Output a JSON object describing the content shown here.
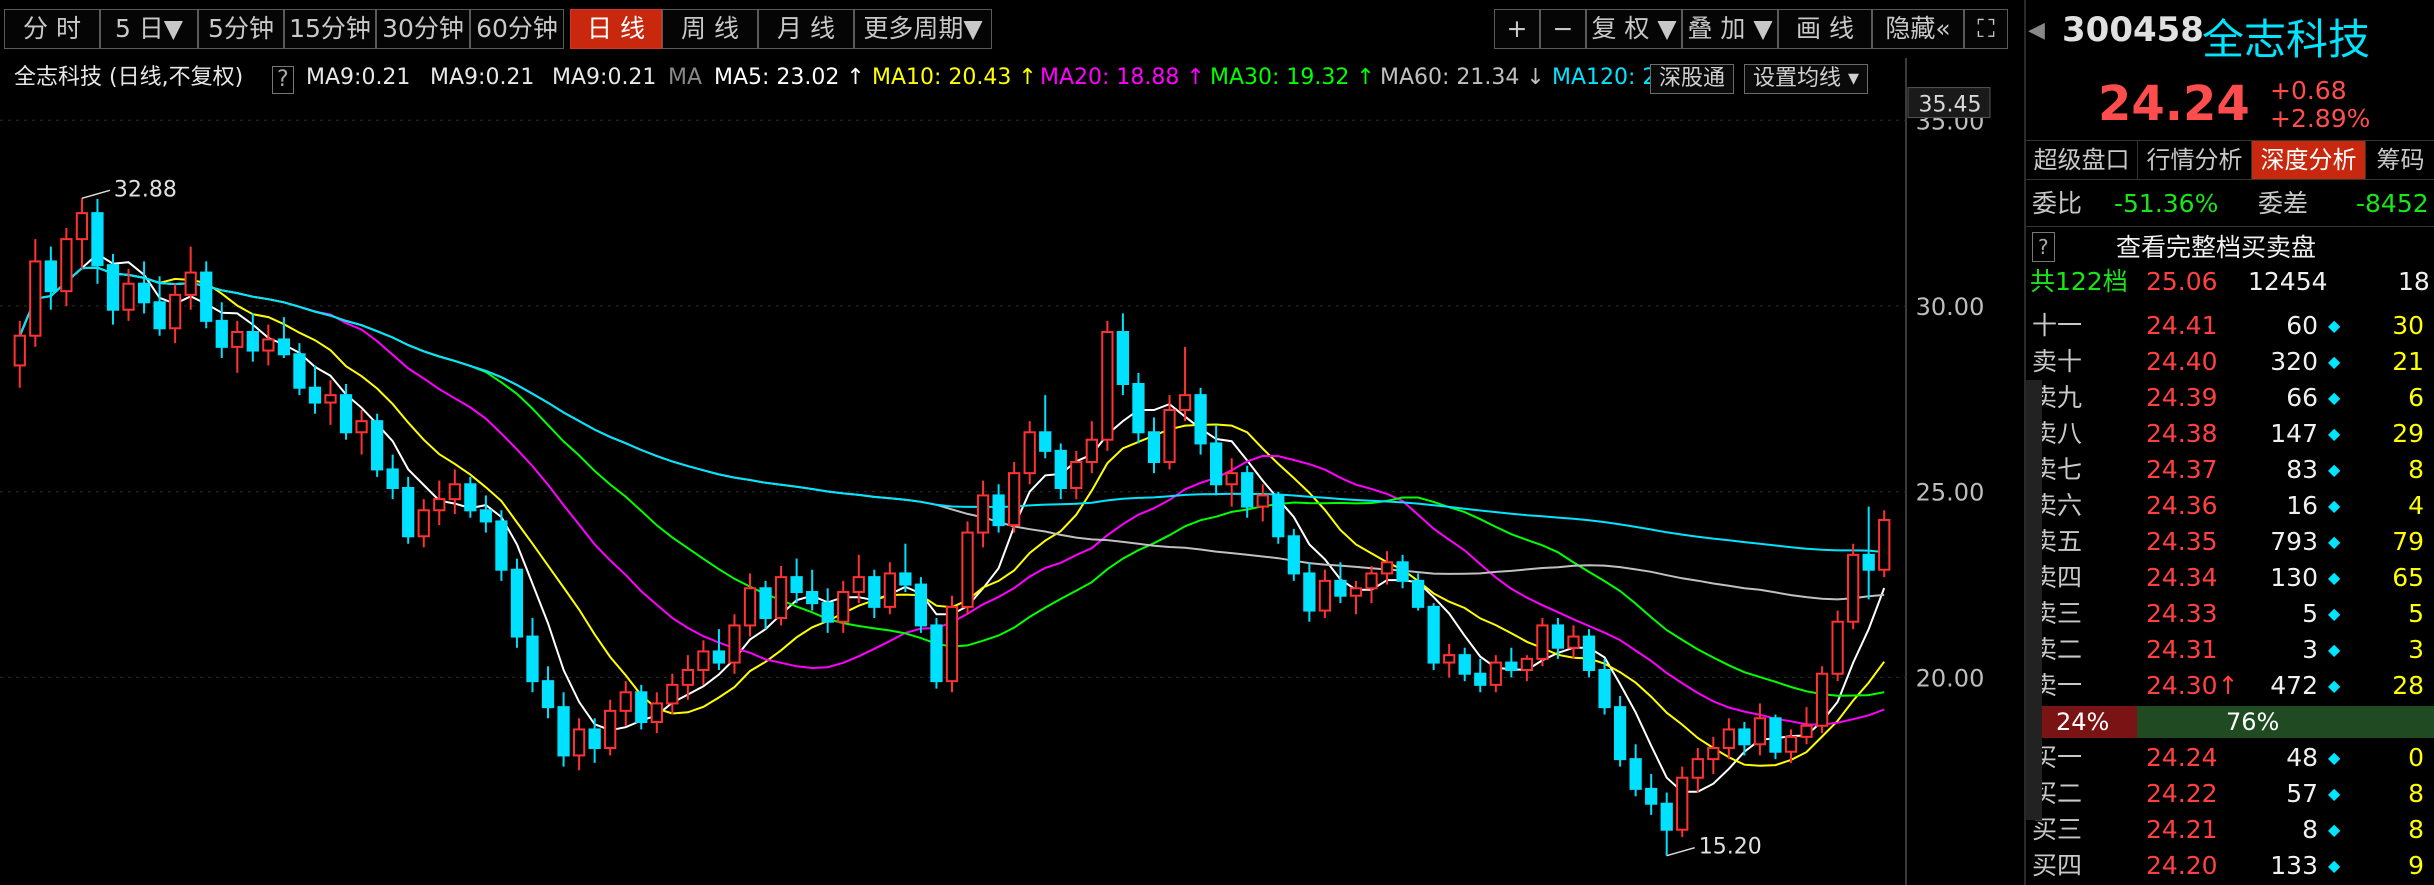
{
  "toolbar": {
    "left_buttons": [
      "分 时",
      "5 日▼",
      "5分钟",
      "15分钟",
      "30分钟",
      "60分钟",
      "日 线",
      "周 线",
      "月 线",
      "更多周期▼"
    ],
    "active": "日 线",
    "right_buttons": [
      "+",
      "−",
      "复 权 ▼",
      "叠 加 ▼",
      "画 线",
      "隐藏«",
      "⛶"
    ]
  },
  "indicators": {
    "title": "全志科技 (日线,不复权)",
    "help": "?",
    "ma9_a": "MA9:0.21",
    "ma9_b": "MA9:0.21",
    "ma9_c": "MA9:0.21",
    "ma": "MA",
    "ma5": "MA5: 23.02 ↑",
    "ma10": "MA10: 20.43 ↑",
    "ma20": "MA20: 18.88 ↑",
    "ma30": "MA30: 19.32 ↑",
    "ma60": "MA60: 21.34 ↓",
    "ma120": "MA120: 2",
    "deep_link": "深股通",
    "setting": "设置均线 ▾",
    "colors": {
      "ma5": "#ffffff",
      "ma10": "#ffff00",
      "ma20": "#ff00ff",
      "ma30": "#00ff00",
      "ma60": "#c0c0c0",
      "ma120": "#00e5ff"
    }
  },
  "chart_data": {
    "type": "candlestick",
    "y_axis": {
      "ticks": [
        "35.00",
        "30.00",
        "25.00",
        "20.00"
      ],
      "tick_values": [
        35,
        30,
        25,
        20
      ],
      "ylim": [
        14.6,
        35.6
      ],
      "current_marker": "35.45"
    },
    "annotations": {
      "high": "32.88",
      "low": "15.20"
    },
    "candles": [
      [
        28.4,
        29.6,
        27.8,
        29.2
      ],
      [
        29.2,
        31.8,
        28.9,
        31.2
      ],
      [
        31.2,
        31.6,
        29.9,
        30.4
      ],
      [
        30.4,
        32.1,
        30.0,
        31.8
      ],
      [
        31.8,
        32.9,
        31.0,
        32.5
      ],
      [
        32.5,
        32.88,
        30.6,
        31.1
      ],
      [
        31.1,
        31.4,
        29.5,
        29.9
      ],
      [
        29.9,
        31.0,
        29.6,
        30.6
      ],
      [
        30.6,
        31.2,
        29.8,
        30.1
      ],
      [
        30.1,
        30.8,
        29.2,
        29.4
      ],
      [
        29.4,
        30.6,
        29.0,
        30.3
      ],
      [
        30.3,
        31.6,
        29.9,
        30.9
      ],
      [
        30.9,
        31.2,
        29.4,
        29.6
      ],
      [
        29.6,
        30.1,
        28.6,
        28.9
      ],
      [
        28.9,
        29.6,
        28.2,
        29.3
      ],
      [
        29.3,
        29.8,
        28.5,
        28.8
      ],
      [
        28.8,
        29.5,
        28.4,
        29.1
      ],
      [
        29.1,
        29.7,
        28.6,
        28.7
      ],
      [
        28.7,
        29.0,
        27.6,
        27.8
      ],
      [
        27.8,
        28.4,
        27.1,
        27.4
      ],
      [
        27.4,
        28.0,
        26.8,
        27.6
      ],
      [
        27.6,
        27.9,
        26.4,
        26.6
      ],
      [
        26.6,
        27.2,
        26.0,
        26.9
      ],
      [
        26.9,
        27.1,
        25.4,
        25.6
      ],
      [
        25.6,
        26.0,
        24.8,
        25.1
      ],
      [
        25.1,
        25.4,
        23.6,
        23.8
      ],
      [
        23.8,
        24.8,
        23.5,
        24.5
      ],
      [
        24.5,
        25.3,
        24.1,
        24.8
      ],
      [
        24.8,
        25.6,
        24.4,
        25.2
      ],
      [
        25.2,
        25.4,
        24.3,
        24.5
      ],
      [
        24.5,
        24.9,
        23.9,
        24.2
      ],
      [
        24.2,
        24.5,
        22.6,
        22.9
      ],
      [
        22.9,
        23.2,
        20.8,
        21.1
      ],
      [
        21.1,
        21.6,
        19.6,
        19.9
      ],
      [
        19.9,
        20.3,
        18.9,
        19.2
      ],
      [
        19.2,
        19.6,
        17.6,
        17.9
      ],
      [
        17.9,
        18.9,
        17.5,
        18.6
      ],
      [
        18.6,
        18.9,
        17.7,
        18.1
      ],
      [
        18.1,
        19.4,
        17.9,
        19.1
      ],
      [
        19.1,
        19.9,
        18.7,
        19.6
      ],
      [
        19.6,
        19.8,
        18.6,
        18.8
      ],
      [
        18.8,
        19.6,
        18.5,
        19.3
      ],
      [
        19.3,
        20.1,
        19.0,
        19.8
      ],
      [
        19.8,
        20.6,
        19.4,
        20.2
      ],
      [
        20.2,
        21.0,
        19.8,
        20.7
      ],
      [
        20.7,
        21.3,
        20.2,
        20.4
      ],
      [
        20.4,
        21.7,
        20.1,
        21.4
      ],
      [
        21.4,
        22.8,
        21.1,
        22.4
      ],
      [
        22.4,
        22.6,
        21.3,
        21.6
      ],
      [
        21.6,
        23.0,
        21.4,
        22.7
      ],
      [
        22.7,
        23.2,
        22.0,
        22.3
      ],
      [
        22.3,
        22.9,
        21.8,
        22.0
      ],
      [
        22.0,
        22.4,
        21.2,
        21.5
      ],
      [
        21.5,
        22.6,
        21.2,
        22.3
      ],
      [
        22.3,
        23.3,
        22.0,
        22.7
      ],
      [
        22.7,
        22.9,
        21.6,
        21.9
      ],
      [
        21.9,
        23.1,
        21.7,
        22.8
      ],
      [
        22.8,
        23.6,
        22.3,
        22.5
      ],
      [
        22.5,
        22.7,
        21.2,
        21.4
      ],
      [
        21.4,
        21.6,
        19.7,
        19.9
      ],
      [
        19.9,
        22.2,
        19.6,
        21.9
      ],
      [
        21.9,
        24.2,
        21.7,
        23.9
      ],
      [
        23.9,
        25.3,
        23.5,
        24.9
      ],
      [
        24.9,
        25.2,
        23.9,
        24.1
      ],
      [
        24.1,
        25.8,
        23.9,
        25.5
      ],
      [
        25.5,
        26.9,
        25.2,
        26.6
      ],
      [
        26.6,
        27.6,
        25.9,
        26.1
      ],
      [
        26.1,
        26.3,
        24.8,
        25.1
      ],
      [
        25.1,
        26.1,
        24.8,
        25.8
      ],
      [
        25.8,
        26.9,
        25.5,
        26.4
      ],
      [
        26.4,
        29.6,
        26.1,
        29.3
      ],
      [
        29.3,
        29.8,
        27.6,
        27.9
      ],
      [
        27.9,
        28.2,
        26.3,
        26.6
      ],
      [
        26.6,
        27.0,
        25.5,
        25.8
      ],
      [
        25.8,
        27.6,
        25.6,
        27.2
      ],
      [
        27.2,
        28.9,
        26.9,
        27.6
      ],
      [
        27.6,
        27.8,
        26.0,
        26.3
      ],
      [
        26.3,
        26.8,
        24.9,
        25.2
      ],
      [
        25.2,
        25.9,
        24.6,
        25.5
      ],
      [
        25.5,
        25.7,
        24.3,
        24.6
      ],
      [
        24.6,
        25.2,
        24.2,
        24.9
      ],
      [
        24.9,
        25.0,
        23.6,
        23.8
      ],
      [
        23.8,
        24.0,
        22.6,
        22.8
      ],
      [
        22.8,
        23.1,
        21.5,
        21.8
      ],
      [
        21.8,
        22.9,
        21.6,
        22.6
      ],
      [
        22.6,
        23.1,
        22.0,
        22.2
      ],
      [
        22.2,
        22.6,
        21.7,
        22.4
      ],
      [
        22.4,
        23.0,
        22.0,
        22.8
      ],
      [
        22.8,
        23.4,
        22.5,
        23.1
      ],
      [
        23.1,
        23.3,
        22.4,
        22.6
      ],
      [
        22.6,
        22.8,
        21.8,
        21.9
      ],
      [
        21.9,
        22.0,
        20.2,
        20.4
      ],
      [
        20.4,
        20.9,
        20.0,
        20.6
      ],
      [
        20.6,
        20.8,
        19.9,
        20.1
      ],
      [
        20.1,
        20.5,
        19.6,
        19.8
      ],
      [
        19.8,
        20.6,
        19.6,
        20.4
      ],
      [
        20.4,
        20.8,
        20.0,
        20.2
      ],
      [
        20.2,
        20.6,
        19.9,
        20.5
      ],
      [
        20.5,
        21.6,
        20.3,
        21.4
      ],
      [
        21.4,
        21.6,
        20.5,
        20.8
      ],
      [
        20.8,
        21.4,
        20.5,
        21.1
      ],
      [
        21.1,
        21.3,
        20.0,
        20.2
      ],
      [
        20.2,
        20.5,
        19.0,
        19.2
      ],
      [
        19.2,
        19.5,
        17.6,
        17.8
      ],
      [
        17.8,
        18.2,
        16.8,
        17.0
      ],
      [
        17.0,
        17.4,
        16.3,
        16.6
      ],
      [
        16.6,
        16.9,
        15.2,
        15.9
      ],
      [
        15.9,
        17.6,
        15.7,
        17.3
      ],
      [
        17.3,
        18.1,
        16.9,
        17.8
      ],
      [
        17.8,
        18.4,
        17.4,
        18.1
      ],
      [
        18.1,
        18.9,
        17.8,
        18.6
      ],
      [
        18.6,
        18.8,
        17.9,
        18.2
      ],
      [
        18.2,
        19.3,
        17.9,
        18.9
      ],
      [
        18.9,
        19.0,
        17.8,
        18.0
      ],
      [
        18.0,
        18.6,
        17.7,
        18.4
      ],
      [
        18.4,
        19.2,
        18.2,
        18.7
      ],
      [
        18.7,
        20.3,
        18.5,
        20.1
      ],
      [
        20.1,
        21.8,
        19.9,
        21.5
      ],
      [
        21.5,
        23.6,
        21.3,
        23.3
      ],
      [
        23.3,
        24.6,
        22.1,
        22.9
      ],
      [
        22.9,
        24.5,
        22.7,
        24.24
      ]
    ]
  },
  "panel": {
    "code": "300458",
    "name": "全志科技",
    "price": "24.24",
    "change": "+0.68",
    "change_pct": "+2.89%",
    "tabs": [
      "超级盘口",
      "行情分析",
      "深度分析",
      "筹码"
    ],
    "active_tab": "深度分析",
    "weibi_label": "委比",
    "weibi": "-51.36%",
    "weicha_label": "委差",
    "weicha": "-8452",
    "help": "?",
    "full_book": "查看完整档买卖盘",
    "total_label": "共122档",
    "total_price": "25.06",
    "total_vol": "12454",
    "total_count": "18",
    "asks": [
      {
        "label": "十一",
        "price": "24.41",
        "vol": "60",
        "mark": "◆",
        "count": "30"
      },
      {
        "label": "卖十",
        "price": "24.40",
        "vol": "320",
        "mark": "◆",
        "count": "21"
      },
      {
        "label": "卖九",
        "price": "24.39",
        "vol": "66",
        "mark": "◆",
        "count": "6"
      },
      {
        "label": "卖八",
        "price": "24.38",
        "vol": "147",
        "mark": "◆",
        "count": "29"
      },
      {
        "label": "卖七",
        "price": "24.37",
        "vol": "83",
        "mark": "◆",
        "count": "8"
      },
      {
        "label": "卖六",
        "price": "24.36",
        "vol": "16",
        "mark": "◆",
        "count": "4"
      },
      {
        "label": "卖五",
        "price": "24.35",
        "vol": "793",
        "mark": "◆",
        "count": "79"
      },
      {
        "label": "卖四",
        "price": "24.34",
        "vol": "130",
        "mark": "◆",
        "count": "65"
      },
      {
        "label": "卖三",
        "price": "24.33",
        "vol": "5",
        "mark": "◆",
        "count": "5"
      },
      {
        "label": "卖二",
        "price": "24.31",
        "vol": "3",
        "mark": "◆",
        "count": "3"
      },
      {
        "label": "卖一",
        "price": "24.30↑",
        "vol": "472",
        "mark": "◆",
        "count": "28"
      }
    ],
    "ask_ratio": "24%",
    "bid_ratio": "76%",
    "ask_ratio_value": 0.24,
    "bids": [
      {
        "label": "买一",
        "price": "24.24",
        "vol": "48",
        "mark": "◆",
        "count": "0"
      },
      {
        "label": "买二",
        "price": "24.22",
        "vol": "57",
        "mark": "◆",
        "count": "8"
      },
      {
        "label": "买三",
        "price": "24.21",
        "vol": "8",
        "mark": "◆",
        "count": "8"
      },
      {
        "label": "买四",
        "price": "24.20",
        "vol": "133",
        "mark": "◆",
        "count": "9"
      }
    ]
  }
}
